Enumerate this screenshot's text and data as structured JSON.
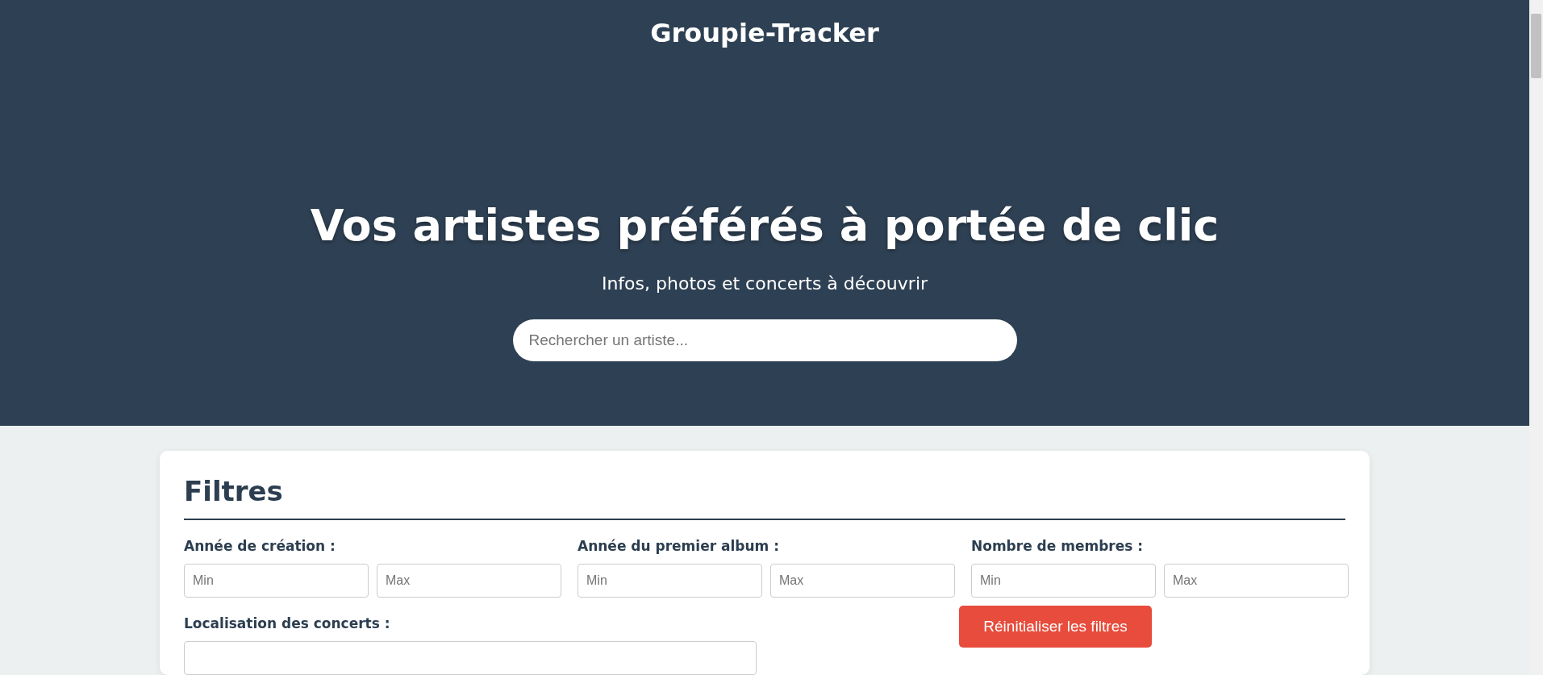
{
  "brand": "Groupie-Tracker",
  "hero": {
    "title": "Vos artistes préférés à portée de clic",
    "subtitle": "Infos, photos et concerts à découvrir",
    "search": {
      "placeholder": "Rechercher un artiste..."
    }
  },
  "filters": {
    "title": "Filtres",
    "ranges": [
      {
        "label": "Année de création :",
        "min_placeholder": "Min",
        "max_placeholder": "Max"
      },
      {
        "label": "Année du premier album :",
        "min_placeholder": "Min",
        "max_placeholder": "Max"
      },
      {
        "label": "Nombre de membres :",
        "min_placeholder": "Min",
        "max_placeholder": "Max"
      }
    ],
    "location": {
      "label": "Localisation des concerts :"
    },
    "reset_button": "Réinitialiser les filtres"
  }
}
